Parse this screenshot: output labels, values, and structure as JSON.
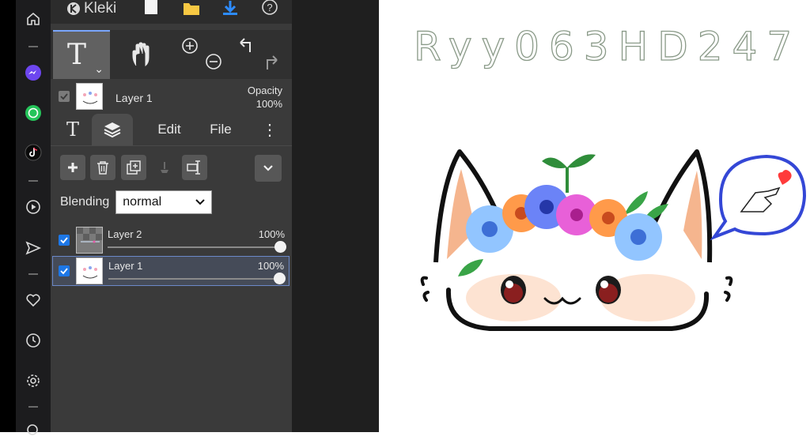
{
  "app": {
    "brand": "Kleki"
  },
  "tools": {
    "text_glyph": "T",
    "caret": "⌄"
  },
  "layer_header": {
    "name": "Layer 1",
    "opacity_label": "Opacity",
    "opacity_value": "100%"
  },
  "tabs": [
    {
      "label": "T"
    },
    {
      "label": ""
    },
    {
      "label": "Edit"
    },
    {
      "label": "File"
    },
    {
      "label": "⋮"
    }
  ],
  "blending": {
    "label": "Blending",
    "value": "normal"
  },
  "layers": [
    {
      "name": "Layer 2",
      "opacity": "100%",
      "checked": true,
      "selected": false
    },
    {
      "name": "Layer 1",
      "opacity": "100%",
      "checked": true,
      "selected": true
    }
  ],
  "canvas": {
    "signature": "Ryy063HD247"
  },
  "browser_sidebar": [
    "home-icon",
    "messenger-icon",
    "whatsapp-icon",
    "tiktok-icon",
    "player-icon",
    "send-icon",
    "heart-icon",
    "clock-icon",
    "gear-icon",
    "search-icon"
  ],
  "colors": {
    "panel": "#3a3a3a",
    "accent": "#1d77e6",
    "active_tool": "#616161"
  }
}
